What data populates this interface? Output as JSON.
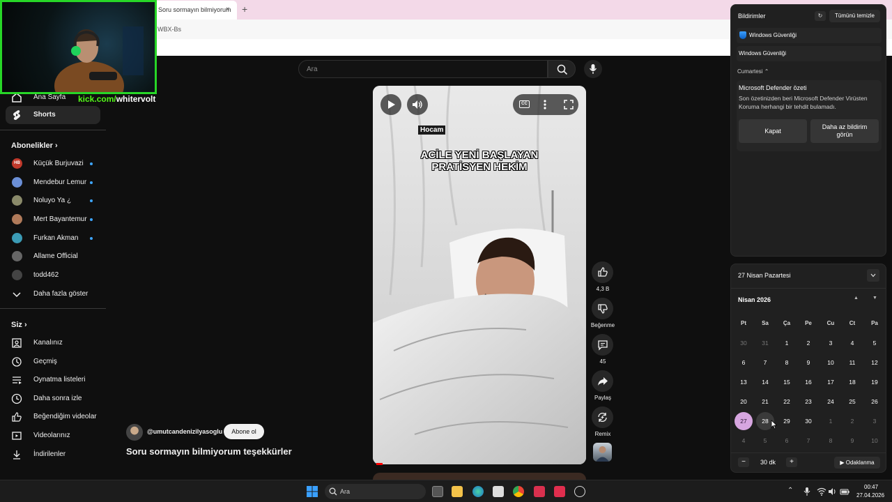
{
  "browser": {
    "tab_title": "Soru sormayın bilmiyorum",
    "tab_close": "×",
    "new_tab": "+",
    "bookmark": "WBX-Bs"
  },
  "webcam": {
    "overlay_prefix": "kick.com/",
    "overlay_handle": "whitervolt"
  },
  "search": {
    "placeholder": "Ara"
  },
  "sidebar": {
    "home": "Ana Sayfa",
    "shorts": "Shorts",
    "subscriptions_title": "Abonelikler",
    "subscriptions": [
      {
        "name": "Küçük Burjuvazi",
        "avatar_text": "HB",
        "color": "#c0392b"
      },
      {
        "name": "Mendebur Lemur",
        "avatar_text": "",
        "color": "#6b8fd6"
      },
      {
        "name": "Noluyo Ya ¿",
        "avatar_text": "",
        "color": "#8a8a6a"
      },
      {
        "name": "Mert Bayantemur",
        "avatar_text": "",
        "color": "#b07a5a"
      },
      {
        "name": "Furkan Akman",
        "avatar_text": "",
        "color": "#3b9bb5"
      },
      {
        "name": "Allame Official",
        "avatar_text": "",
        "color": "#666666"
      },
      {
        "name": "todd462",
        "avatar_text": "",
        "color": "#444444"
      }
    ],
    "show_more": "Daha fazla göster",
    "you_title": "Siz",
    "you_items": [
      {
        "label": "Kanalınız",
        "icon": "channel-icon"
      },
      {
        "label": "Geçmiş",
        "icon": "history-icon"
      },
      {
        "label": "Oynatma listeleri",
        "icon": "playlists-icon"
      },
      {
        "label": "Daha sonra izle",
        "icon": "watch-later-icon"
      },
      {
        "label": "Beğendiğim videolar",
        "icon": "liked-icon"
      },
      {
        "label": "Videolarınız",
        "icon": "your-videos-icon"
      },
      {
        "label": "İndirilenler",
        "icon": "downloads-icon"
      }
    ]
  },
  "video": {
    "label_tag": "Hocam",
    "caption_line1": "ACİLE YENİ BAŞLAYAN",
    "caption_line2": "PRATİSYEN HEKİM",
    "cc_label": "CC",
    "progress_fraction": 0.03
  },
  "actions": {
    "like_count": "4,3 B",
    "dislike_label": "Beğenme",
    "comment_count": "45",
    "share_label": "Paylaş",
    "remix_label": "Remix"
  },
  "channel": {
    "handle": "@umutcandenizilyasoglu",
    "subscribe": "Abone ol",
    "title": "Soru sormayın bilmiyorum teşekkürler"
  },
  "notifications": {
    "title": "Bildirimler",
    "clear_all": "Tümünü temizle",
    "app_row1": "Windows Güvenliği",
    "app_row2": "Windows Güvenliği",
    "group_label": "Cumartesi",
    "card_title": "Microsoft Defender özeti",
    "card_body": "Son özetinizden beri Microsoft Defender Virüsten Koruma herhangi bir tehdit bulamadı.",
    "btn_close": "Kapat",
    "btn_less_line1": "Daha az bildirim",
    "btn_less_line2": "görün"
  },
  "calendar": {
    "date_header": "27 Nisan Pazartesi",
    "month": "Nisan 2026",
    "weekdays": [
      "Pt",
      "Sa",
      "Ça",
      "Pe",
      "Cu",
      "Ct",
      "Pa"
    ],
    "weeks": [
      [
        "30",
        "31",
        "1",
        "2",
        "3",
        "4",
        "5"
      ],
      [
        "6",
        "7",
        "8",
        "9",
        "10",
        "11",
        "12"
      ],
      [
        "13",
        "14",
        "15",
        "16",
        "17",
        "18",
        "19"
      ],
      [
        "20",
        "21",
        "22",
        "23",
        "24",
        "25",
        "26"
      ],
      [
        "27",
        "28",
        "29",
        "30",
        "1",
        "2",
        "3"
      ],
      [
        "4",
        "5",
        "6",
        "7",
        "8",
        "9",
        "10"
      ]
    ],
    "today": "27",
    "focus_minus": "−",
    "focus_value": "30 dk",
    "focus_plus": "+",
    "focus_button": "Odaklanma"
  },
  "taskbar": {
    "search_placeholder": "Ara",
    "time": "00:47",
    "date": "27.04.2026"
  }
}
